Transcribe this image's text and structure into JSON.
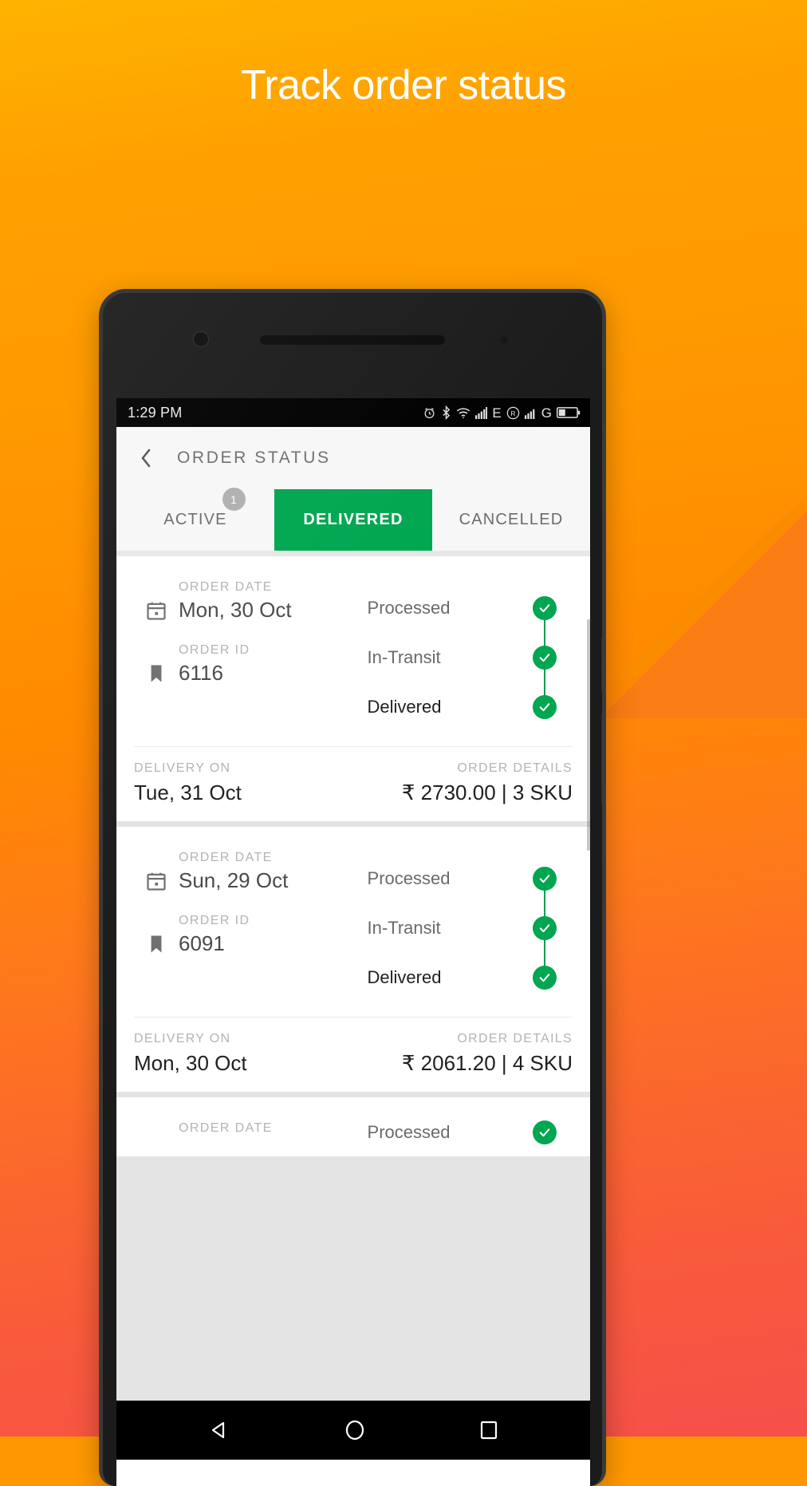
{
  "promo": {
    "headline": "Track order status",
    "accent_color": "#00a650",
    "bg_top_color": "#ffb300",
    "bg_bottom_color": "#f5504a"
  },
  "statusbar": {
    "time": "1:29 PM",
    "icons": [
      "alarm-icon",
      "bluetooth-icon",
      "wifi-icon",
      "signal-bars-icon",
      "network-e-icon",
      "roaming-icon",
      "signal-bars-2-icon",
      "network-g-icon",
      "battery-icon"
    ],
    "network_1_label": "E",
    "roaming_label": "R",
    "network_2_label": "G"
  },
  "appbar": {
    "back_icon": "chevron-left-icon",
    "title": "ORDER STATUS"
  },
  "tabs": [
    {
      "label": "ACTIVE",
      "active": false,
      "badge": "1"
    },
    {
      "label": "DELIVERED",
      "active": true,
      "badge": ""
    },
    {
      "label": "CANCELLED",
      "active": false,
      "badge": ""
    }
  ],
  "labels": {
    "order_date": "ORDER DATE",
    "order_id": "ORDER ID",
    "delivery_on": "DELIVERY ON",
    "order_details": "ORDER DETAILS"
  },
  "timeline_steps": [
    "Processed",
    "In-Transit",
    "Delivered"
  ],
  "orders": [
    {
      "order_date": "Mon, 30 Oct",
      "order_id": "6116",
      "delivery_on": "Tue, 31 Oct",
      "order_details": "₹ 2730.00 | 3 SKU",
      "steps": [
        "Processed",
        "In-Transit",
        "Delivered"
      ]
    },
    {
      "order_date": "Sun, 29 Oct",
      "order_id": "6091",
      "delivery_on": "Mon, 30 Oct",
      "order_details": "₹ 2061.20 | 4 SKU",
      "steps": [
        "Processed",
        "In-Transit",
        "Delivered"
      ]
    }
  ],
  "partial_order": {
    "order_date_label": "ORDER DATE",
    "first_step": "Processed"
  },
  "navbar": {
    "back": "nav-back-triangle-icon",
    "home": "nav-home-circle-icon",
    "recents": "nav-recents-square-icon"
  }
}
